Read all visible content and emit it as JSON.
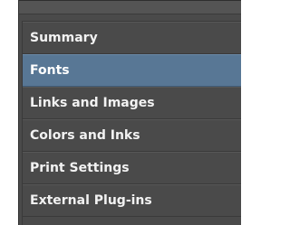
{
  "sidebar": {
    "items": [
      {
        "label": "Summary",
        "selected": false
      },
      {
        "label": "Fonts",
        "selected": true
      },
      {
        "label": "Links and Images",
        "selected": false
      },
      {
        "label": "Colors and Inks",
        "selected": false
      },
      {
        "label": "Print Settings",
        "selected": false
      },
      {
        "label": "External Plug-ins",
        "selected": false
      }
    ]
  },
  "colors": {
    "panel_background": "#4a4a4a",
    "selection": "#587795",
    "text": "#f2f2f2"
  }
}
